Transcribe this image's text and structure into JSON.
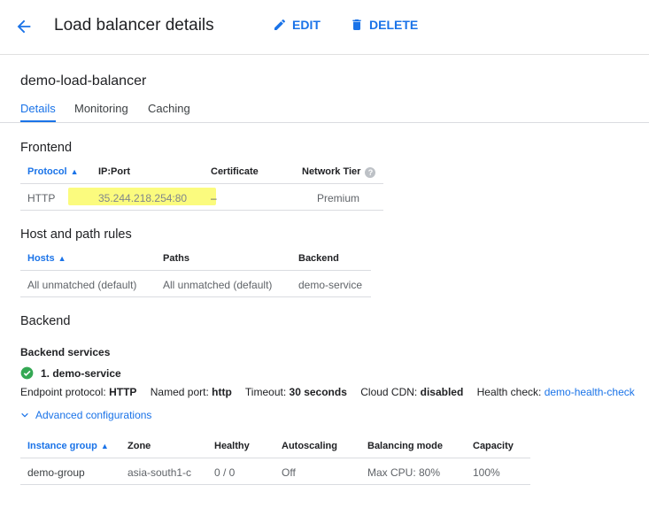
{
  "header": {
    "title": "Load balancer details",
    "edit_label": "EDIT",
    "delete_label": "DELETE"
  },
  "load_balancer": {
    "name": "demo-load-balancer"
  },
  "tabs": [
    {
      "label": "Details",
      "active": true
    },
    {
      "label": "Monitoring",
      "active": false
    },
    {
      "label": "Caching",
      "active": false
    }
  ],
  "frontend": {
    "title": "Frontend",
    "headers": {
      "protocol": "Protocol",
      "ip_port": "IP:Port",
      "certificate": "Certificate",
      "network_tier": "Network Tier"
    },
    "rows": [
      {
        "protocol": "HTTP",
        "ip_port": "35.244.218.254:80",
        "certificate": "–",
        "network_tier": "Premium"
      }
    ]
  },
  "host_path_rules": {
    "title": "Host and path rules",
    "headers": {
      "hosts": "Hosts",
      "paths": "Paths",
      "backend": "Backend"
    },
    "rows": [
      {
        "hosts": "All unmatched (default)",
        "paths": "All unmatched (default)",
        "backend": "demo-service"
      }
    ]
  },
  "backend": {
    "title": "Backend",
    "services_title": "Backend services",
    "service_name": "1. demo-service",
    "endpoint_protocol_label": "Endpoint protocol:",
    "endpoint_protocol": "HTTP",
    "named_port_label": "Named port:",
    "named_port": "http",
    "timeout_label": "Timeout:",
    "timeout": "30 seconds",
    "cloud_cdn_label": "Cloud CDN:",
    "cloud_cdn": "disabled",
    "health_check_label": "Health check:",
    "health_check": "demo-health-check",
    "advanced_label": "Advanced configurations",
    "headers": {
      "instance_group": "Instance group",
      "zone": "Zone",
      "healthy": "Healthy",
      "autoscaling": "Autoscaling",
      "balancing_mode": "Balancing mode",
      "capacity": "Capacity"
    },
    "rows": [
      {
        "instance_group": "demo-group",
        "zone": "asia-south1-c",
        "healthy": "0 / 0",
        "autoscaling": "Off",
        "balancing_mode": "Max CPU: 80%",
        "capacity": "100%"
      }
    ]
  },
  "colors": {
    "accent": "#1a73e8",
    "success": "#34a853",
    "highlight": "#fbfb7e"
  },
  "icons": {
    "back": "arrow-back-icon",
    "edit": "pencil-icon",
    "delete": "trash-icon",
    "sort": "arrow-up-icon",
    "help": "help-icon",
    "status": "check-circle-icon",
    "expand": "chevron-down-icon"
  }
}
